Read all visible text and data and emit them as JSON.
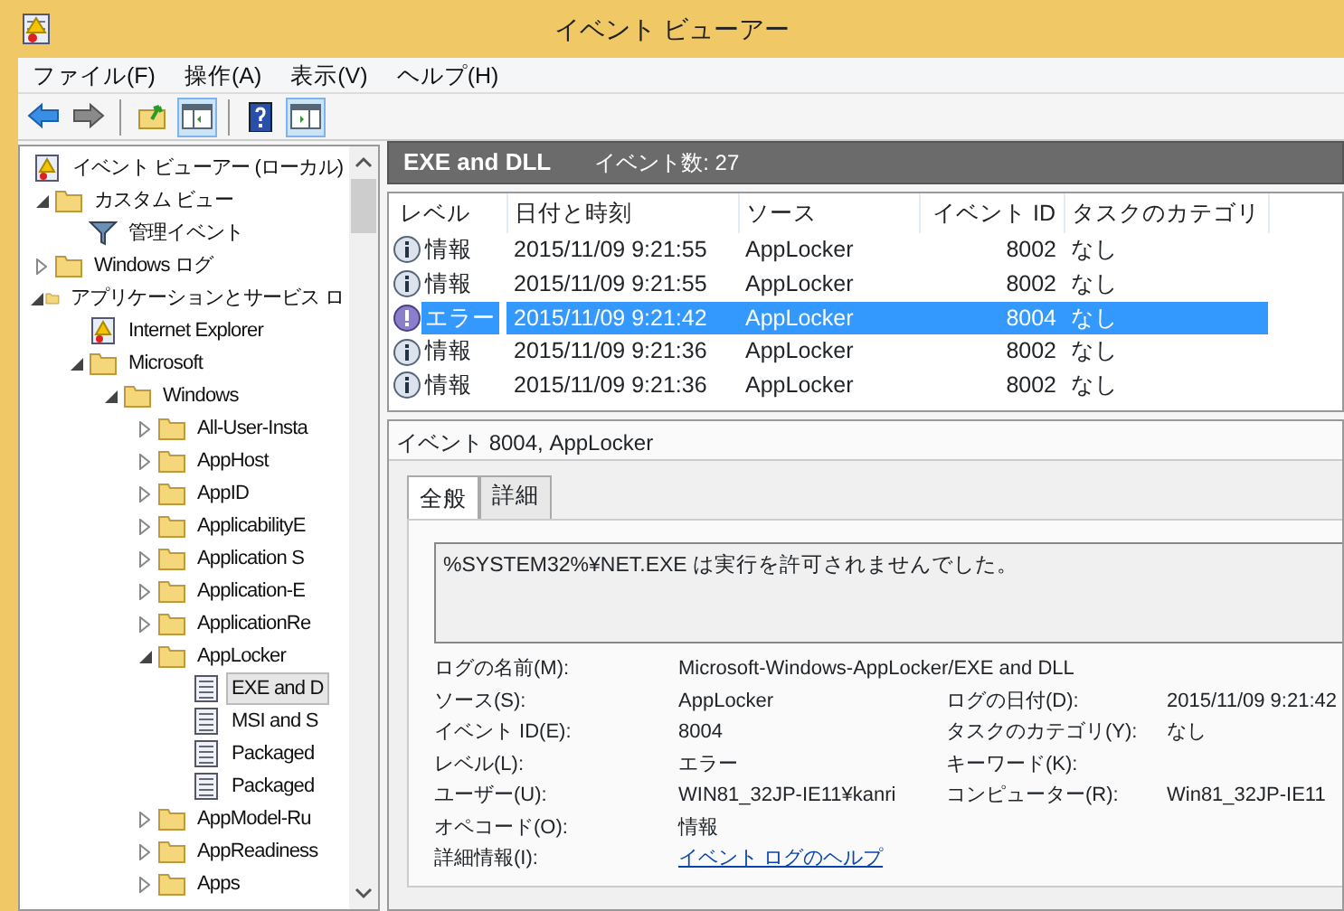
{
  "window": {
    "title": "イベント ビューアー"
  },
  "menu": [
    "ファイル(F)",
    "操作(A)",
    "表示(V)",
    "ヘルプ(H)"
  ],
  "toolbar": [
    {
      "kind": "back",
      "pressed": false
    },
    {
      "kind": "forward",
      "pressed": false
    },
    {
      "kind": "sep"
    },
    {
      "kind": "up",
      "pressed": false
    },
    {
      "kind": "tree",
      "pressed": true
    },
    {
      "kind": "sep"
    },
    {
      "kind": "help",
      "pressed": false
    },
    {
      "kind": "actions",
      "pressed": true
    }
  ],
  "tree": [
    {
      "label": "イベント ビューアー (ローカル)",
      "kind": "viewer",
      "selected": false,
      "children": [
        {
          "label": "カスタム ビュー",
          "kind": "folder",
          "expanded": true,
          "selected": false,
          "children": [
            {
              "label": "管理イベント",
              "kind": "filter",
              "selected": false
            }
          ]
        },
        {
          "label": "Windows ログ",
          "kind": "folder",
          "expanded": false,
          "selected": false
        },
        {
          "label": "アプリケーションとサービス ロ",
          "kind": "folder",
          "expanded": true,
          "selected": false,
          "children": [
            {
              "label": "Internet Explorer",
              "kind": "viewer",
              "selected": false
            },
            {
              "label": "Microsoft",
              "kind": "folder",
              "expanded": true,
              "selected": false,
              "children": [
                {
                  "label": "Windows",
                  "kind": "folder",
                  "expanded": true,
                  "selected": false,
                  "children": [
                    {
                      "label": "All-User-Insta",
                      "kind": "folder",
                      "expanded": false,
                      "selected": false
                    },
                    {
                      "label": "AppHost",
                      "kind": "folder",
                      "expanded": false,
                      "selected": false
                    },
                    {
                      "label": "AppID",
                      "kind": "folder",
                      "expanded": false,
                      "selected": false
                    },
                    {
                      "label": "ApplicabilityE",
                      "kind": "folder",
                      "expanded": false,
                      "selected": false
                    },
                    {
                      "label": "Application S",
                      "kind": "folder",
                      "expanded": false,
                      "selected": false
                    },
                    {
                      "label": "Application-E",
                      "kind": "folder",
                      "expanded": false,
                      "selected": false
                    },
                    {
                      "label": "ApplicationRe",
                      "kind": "folder",
                      "expanded": false,
                      "selected": false
                    },
                    {
                      "label": "AppLocker",
                      "kind": "folder",
                      "expanded": true,
                      "selected": false,
                      "children": [
                        {
                          "label": "EXE and D",
                          "kind": "log",
                          "selected": true
                        },
                        {
                          "label": "MSI and S",
                          "kind": "log",
                          "selected": false
                        },
                        {
                          "label": "Packaged",
                          "kind": "log",
                          "selected": false
                        },
                        {
                          "label": "Packaged",
                          "kind": "log",
                          "selected": false
                        }
                      ]
                    },
                    {
                      "label": "AppModel-Ru",
                      "kind": "folder",
                      "expanded": false,
                      "selected": false
                    },
                    {
                      "label": "AppReadiness",
                      "kind": "folder",
                      "expanded": false,
                      "selected": false
                    },
                    {
                      "label": "Apps",
                      "kind": "folder",
                      "expanded": false,
                      "selected": false
                    }
                  ]
                }
              ]
            }
          ]
        }
      ]
    }
  ],
  "log": {
    "title": "EXE and DLL",
    "count": "イベント数: 27"
  },
  "table": {
    "columns": [
      "レベル",
      "日付と時刻",
      "ソース",
      "イベント ID",
      "タスクのカテゴリ"
    ],
    "rows": [
      {
        "kind": "info",
        "selected": false,
        "cells": [
          "情報",
          "2015/11/09 9:21:55",
          "AppLocker",
          "8002",
          "なし"
        ]
      },
      {
        "kind": "info",
        "selected": false,
        "cells": [
          "情報",
          "2015/11/09 9:21:55",
          "AppLocker",
          "8002",
          "なし"
        ]
      },
      {
        "kind": "error",
        "selected": true,
        "cells": [
          "エラー",
          "2015/11/09 9:21:42",
          "AppLocker",
          "8004",
          "なし"
        ]
      },
      {
        "kind": "info",
        "selected": false,
        "cells": [
          "情報",
          "2015/11/09 9:21:36",
          "AppLocker",
          "8002",
          "なし"
        ]
      },
      {
        "kind": "info",
        "selected": false,
        "cells": [
          "情報",
          "2015/11/09 9:21:36",
          "AppLocker",
          "8002",
          "なし"
        ]
      }
    ]
  },
  "details": {
    "title": "イベント 8004, AppLocker",
    "tabs": [
      {
        "label": "全般",
        "selected": true
      },
      {
        "label": "詳細",
        "selected": false
      }
    ],
    "message": "%SYSTEM32%¥NET.EXE は実行を許可されませんでした。",
    "rows": [
      [
        {
          "label": "ログの名前(M):",
          "value": "Microsoft-Windows-AppLocker/EXE and DLL"
        }
      ],
      [
        {
          "label": "ソース(S):",
          "value": "AppLocker"
        },
        {
          "label": "ログの日付(D):",
          "value": "2015/11/09 9:21:42"
        }
      ],
      [
        {
          "label": "イベント ID(E):",
          "value": "8004"
        },
        {
          "label": "タスクのカテゴリ(Y):",
          "value": "なし"
        }
      ],
      [
        {
          "label": "レベル(L):",
          "value": "エラー"
        },
        {
          "label": "キーワード(K):"
        }
      ],
      [
        {
          "label": "ユーザー(U):",
          "value": "WIN81_32JP-IE11¥kanri"
        },
        {
          "label": "コンピューター(R):",
          "value": "Win81_32JP-IE11"
        }
      ],
      [
        {
          "label": "オペコード(O):",
          "value": "情報"
        }
      ],
      [
        {
          "label": "詳細情報(I):",
          "value": "イベント ログのヘルプ",
          "kind": "link"
        }
      ]
    ]
  }
}
